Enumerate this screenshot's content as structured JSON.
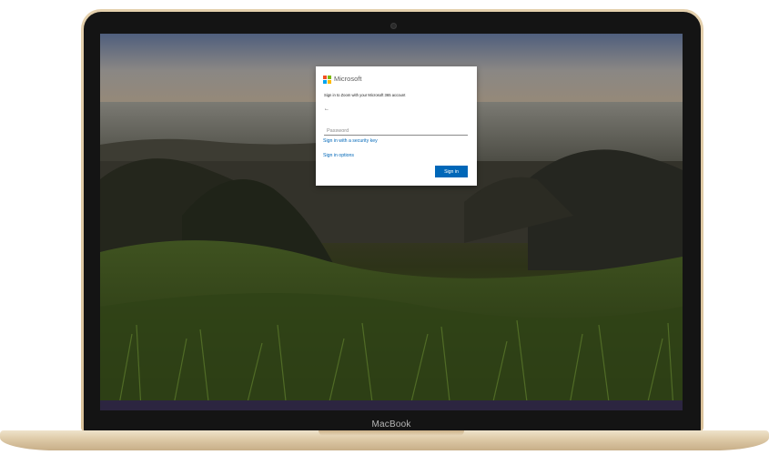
{
  "device": {
    "brand_label": "MacBook"
  },
  "login": {
    "brand_name": "Microsoft",
    "logo_colors": [
      "#f25022",
      "#7fba00",
      "#00a4ef",
      "#ffb900"
    ],
    "subtitle": "Sign in to Zoom with your Microsoft 365 account",
    "back_icon": "back-arrow-icon",
    "back_glyph": "←",
    "password_placeholder": "Password",
    "password_value": "",
    "security_key_link": "Sign in with a security key",
    "sign_in_options_link": "Sign in options",
    "sign_in_button": "Sign in"
  },
  "colors": {
    "accent": "#0067b8",
    "laptop_gold": "#d9c19a"
  }
}
